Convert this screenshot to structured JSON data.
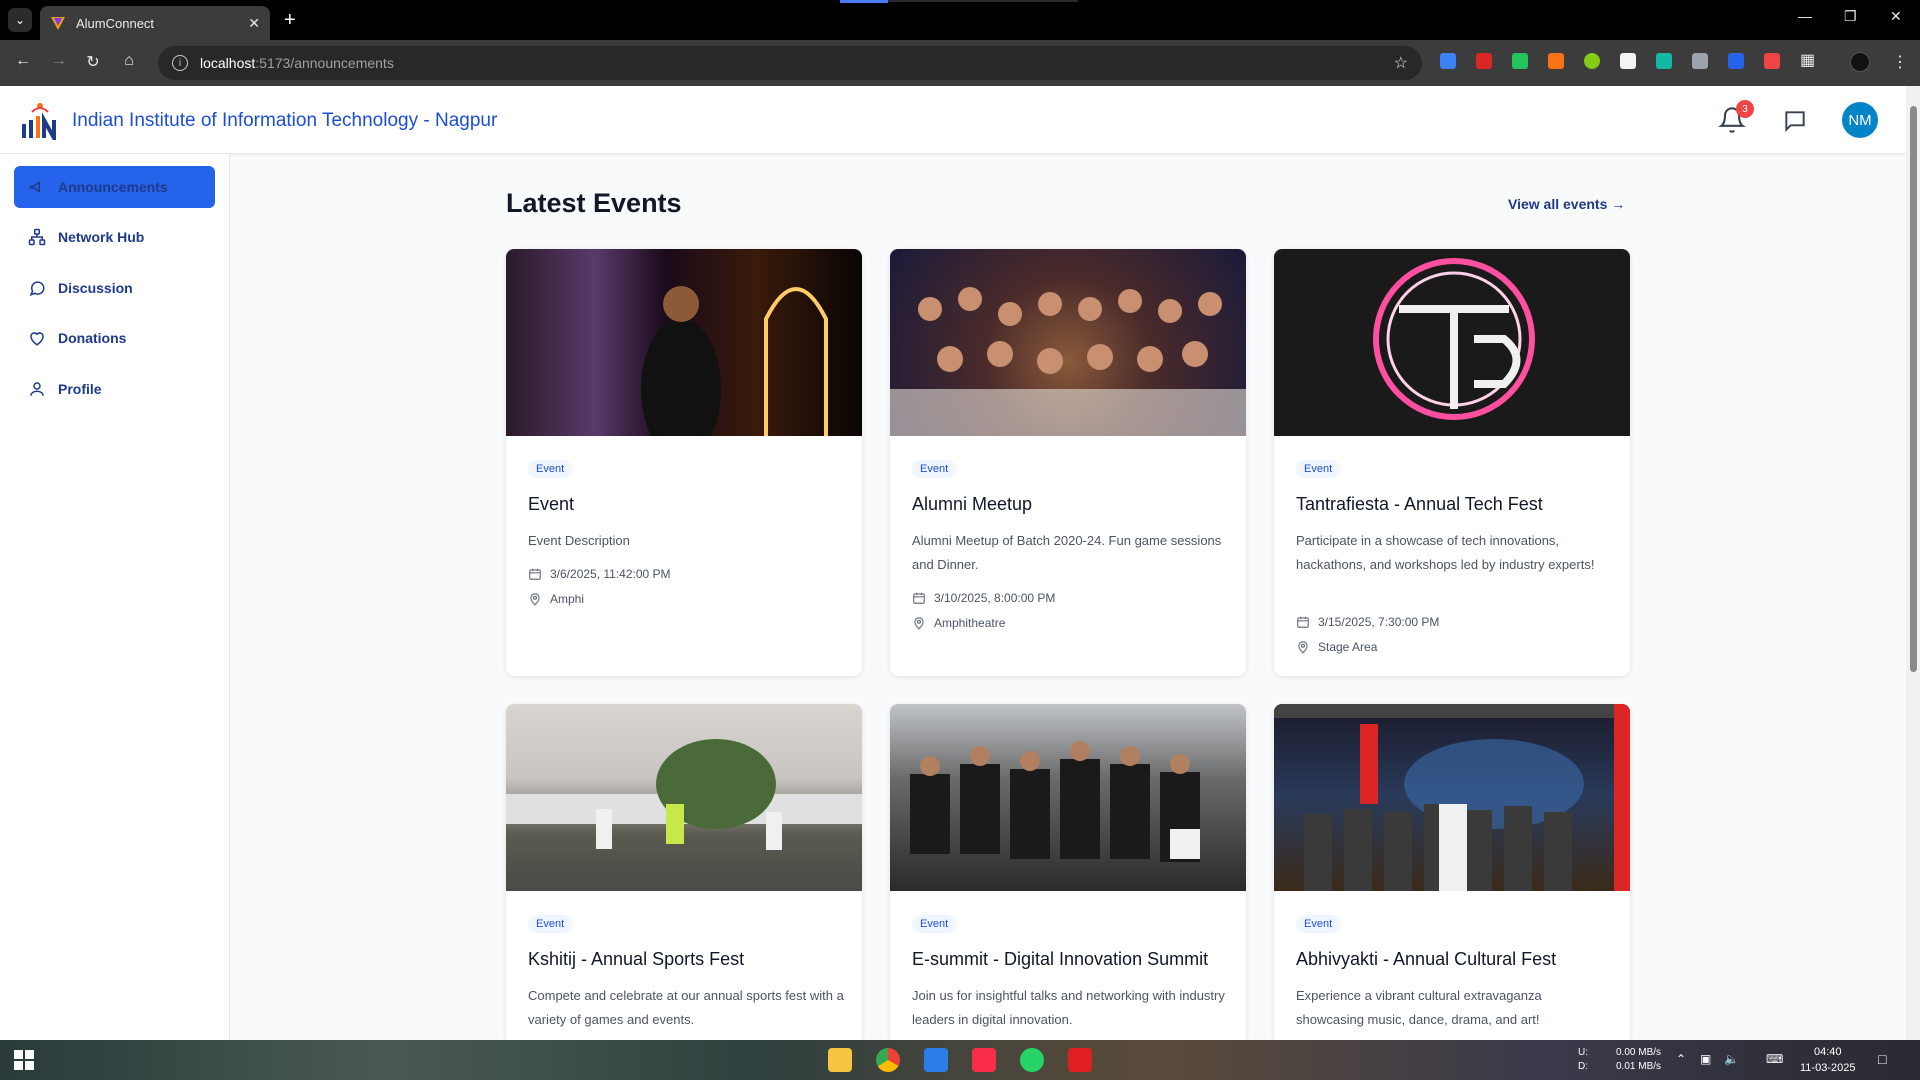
{
  "browser": {
    "tab_title": "AlumConnect",
    "url_host": "localhost",
    "url_path": ":5173/announcements"
  },
  "header": {
    "institute_name": "Indian Institute of Information Technology - Nagpur",
    "notification_count": "3",
    "avatar_initials": "NM"
  },
  "sidebar": {
    "items": [
      {
        "label": "Announcements",
        "icon": "megaphone-icon",
        "active": true
      },
      {
        "label": "Network Hub",
        "icon": "network-icon"
      },
      {
        "label": "Discussion",
        "icon": "chat-bubble-icon"
      },
      {
        "label": "Donations",
        "icon": "heart-icon"
      },
      {
        "label": "Profile",
        "icon": "user-icon"
      }
    ]
  },
  "main": {
    "title": "Latest Events",
    "view_all": "View all events",
    "events": [
      {
        "tag": "Event",
        "title": "Event",
        "description": "Event Description",
        "datetime": "3/6/2025, 11:42:00 PM",
        "location": "Amphi"
      },
      {
        "tag": "Event",
        "title": "Alumni Meetup",
        "description": "Alumni Meetup of Batch 2020-24. Fun game sessions and Dinner.",
        "datetime": "3/10/2025, 8:00:00 PM",
        "location": "Amphitheatre"
      },
      {
        "tag": "Event",
        "title": "Tantrafiesta - Annual Tech Fest",
        "description": "Participate in a showcase of tech innovations, hackathons, and workshops led by industry experts!",
        "datetime": "3/15/2025, 7:30:00 PM",
        "location": "Stage Area"
      },
      {
        "tag": "Event",
        "title": "Kshitij - Annual Sports Fest",
        "description": "Compete and celebrate at our annual sports fest with a variety of games and events."
      },
      {
        "tag": "Event",
        "title": "E-summit - Digital Innovation Summit",
        "description": "Join us for insightful talks and networking with industry leaders in digital innovation."
      },
      {
        "tag": "Event",
        "title": "Abhivyakti - Annual Cultural Fest",
        "description": "Experience a vibrant cultural extravaganza showcasing music, dance, drama, and art!"
      }
    ]
  },
  "taskbar": {
    "net_up_label": "U:",
    "net_down_label": "D:",
    "net_up": "0.00 MB/s",
    "net_down": "0.01 MB/s",
    "time": "04:40",
    "date": "11-03-2025"
  },
  "colors": {
    "brand_blue": "#2563eb",
    "link_blue": "#1d4ed8",
    "badge_red": "#ef4444",
    "avatar_bg": "#0284c7"
  }
}
